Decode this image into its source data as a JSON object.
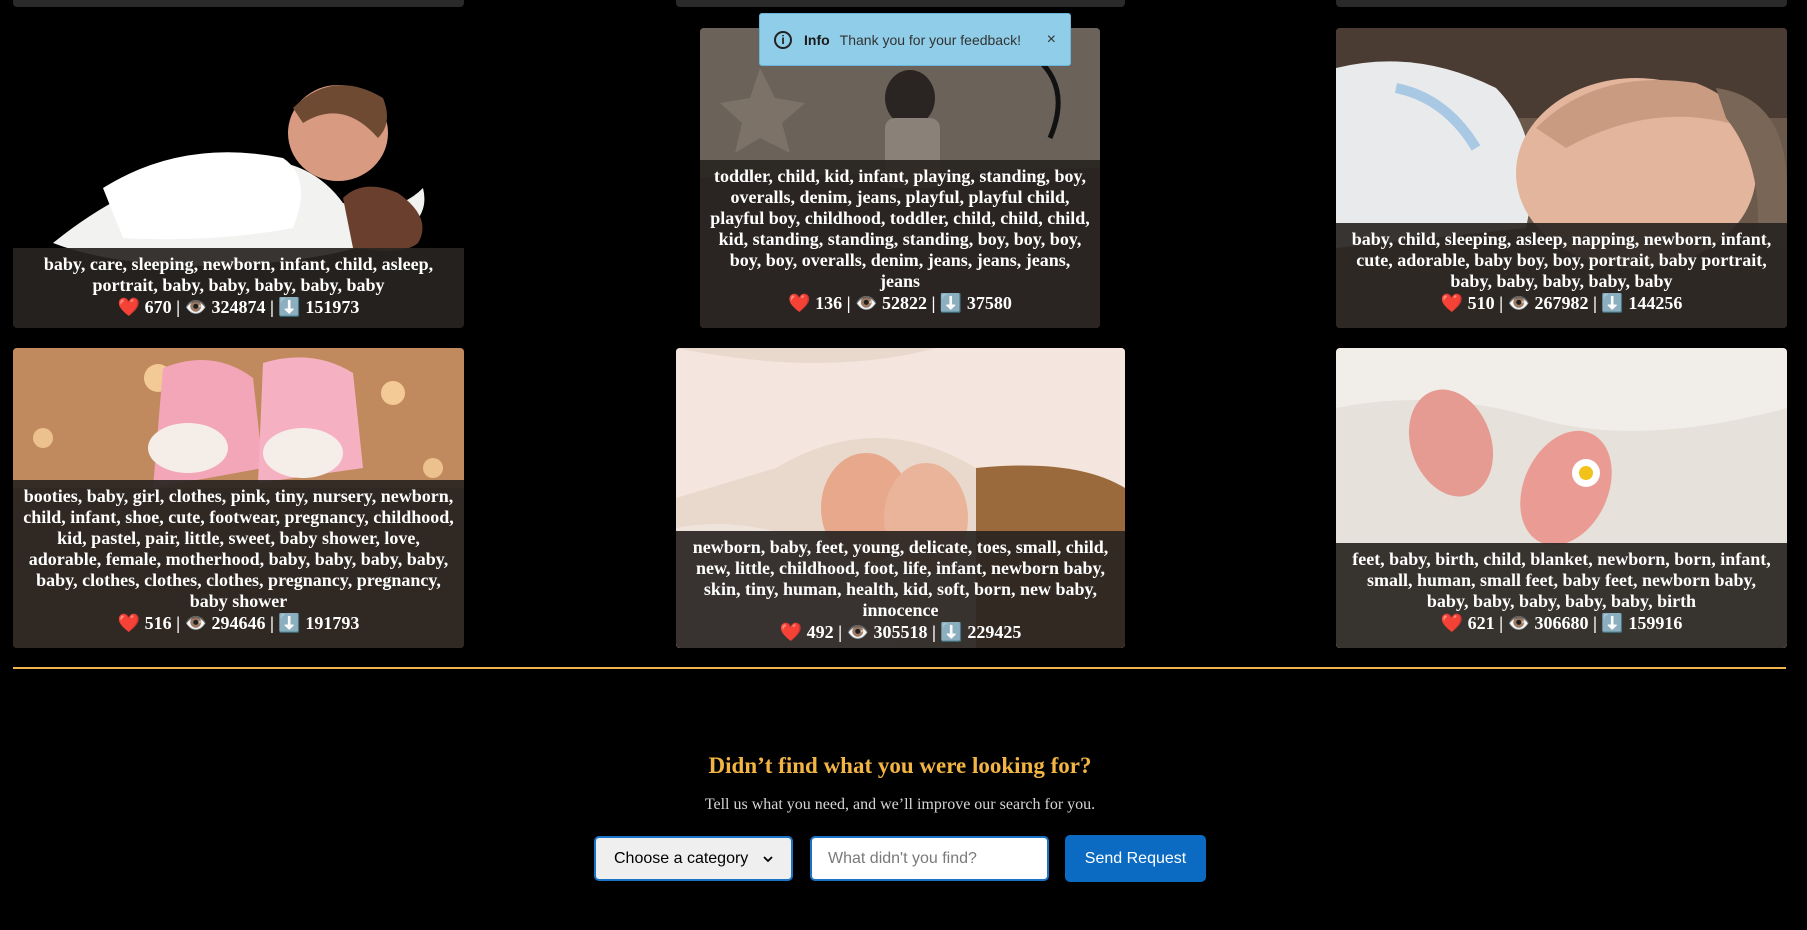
{
  "toast": {
    "title": "Info",
    "message": "Thank you for your feedback!",
    "close": "×"
  },
  "images": [
    {
      "tags": "baby, care, sleeping, newborn, infant, child, asleep, portrait, baby, baby, baby, baby, baby",
      "stats": "❤️ 670 | 👁️ 324874 | ⬇️ 151973"
    },
    {
      "tags": "toddler, child, kid, infant, playing, standing, boy, overalls, denim, jeans, playful, playful child, playful boy, childhood, toddler, child, child, child, kid, standing, standing, standing, boy, boy, boy, boy, boy, overalls, denim, jeans, jeans, jeans, jeans",
      "stats": "❤️ 136 | 👁️ 52822 | ⬇️ 37580"
    },
    {
      "tags": "baby, child, sleeping, asleep, napping, newborn, infant, cute, adorable, baby boy, boy, portrait, baby portrait, baby, baby, baby, baby, baby",
      "stats": "❤️ 510 | 👁️ 267982 | ⬇️ 144256"
    },
    {
      "tags": "booties, baby, girl, clothes, pink, tiny, nursery, newborn, child, infant, shoe, cute, footwear, pregnancy, childhood, kid, pastel, pair, little, sweet, baby shower, love, adorable, female, motherhood, baby, baby, baby, baby, baby, clothes, clothes, clothes, pregnancy, pregnancy, baby shower",
      "stats": "❤️ 516 | 👁️ 294646 | ⬇️ 191793"
    },
    {
      "tags": "newborn, baby, feet, young, delicate, toes, small, child, new, little, childhood, foot, life, infant, newborn baby, skin, tiny, human, health, kid, soft, born, new baby, innocence",
      "stats": "❤️ 492 | 👁️ 305518 | ⬇️ 229425"
    },
    {
      "tags": "feet, baby, birth, child, blanket, newborn, born, infant, small, human, small feet, baby feet, newborn baby, baby, baby, baby, baby, baby, birth",
      "stats": "❤️ 621 | 👁️ 306680 | ⬇️ 159916"
    }
  ],
  "feedback": {
    "heading": "Didn’t find what you were looking for?",
    "subtext": "Tell us what you need, and we’ll improve our search for you.",
    "category_selected": "Choose a category",
    "input_placeholder": "What didn't you find?",
    "send_label": "Send Request"
  },
  "colors": {
    "accent": "#f2b544",
    "button": "#0b6bc2",
    "toast_bg": "#8fcde8"
  }
}
